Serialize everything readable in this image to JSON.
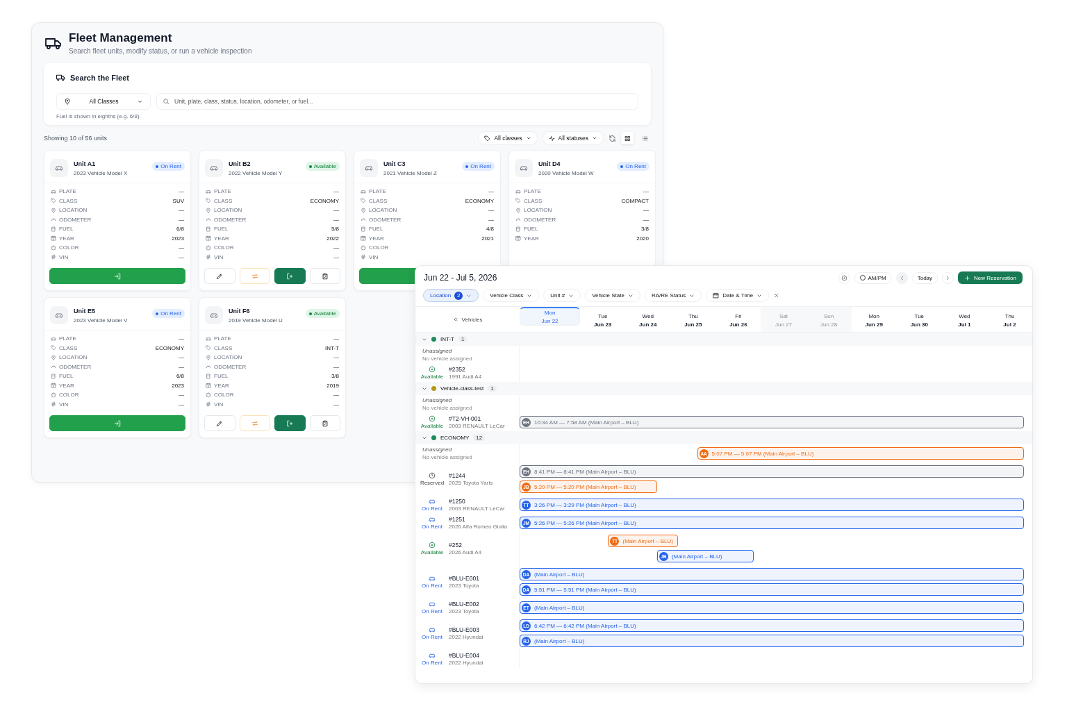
{
  "fleet": {
    "title": "Fleet Management",
    "subtitle": "Search fleet units, modify status, or run a vehicle inspection",
    "search": {
      "title": "Search the Fleet",
      "class_select": "All Classes",
      "placeholder": "Unit, plate, class, status, location, odometer, or fuel...",
      "hint": "Fuel is shown in eighths (e.g. 6/8)."
    },
    "summary": "Showing 10 of 56 units",
    "filters": [
      {
        "kind": "class",
        "label": "All classes"
      },
      {
        "kind": "status",
        "label": "All statuses"
      }
    ],
    "views": [
      {
        "kind": "grid",
        "selected": true
      },
      {
        "kind": "list",
        "selected": false
      }
    ],
    "cards": [
      {
        "unit": "Unit A1",
        "model": "2023 Vehicle Model X",
        "status": {
          "label": "On Rent",
          "kind": "rent"
        },
        "fields": [
          {
            "kind": "plate",
            "label": "PLATE",
            "value": "—"
          },
          {
            "kind": "class",
            "label": "CLASS",
            "value": "SUV"
          },
          {
            "kind": "location",
            "label": "LOCATION",
            "value": "—"
          },
          {
            "kind": "odometer",
            "label": "ODOMETER",
            "value": "—"
          },
          {
            "kind": "fuel",
            "label": "FUEL",
            "value": "6/8"
          },
          {
            "kind": "year",
            "label": "YEAR",
            "value": "2023"
          },
          {
            "kind": "color",
            "label": "COLOR",
            "value": "—"
          },
          {
            "kind": "vin",
            "label": "VIN",
            "value": "—"
          }
        ],
        "actions": [
          {
            "kind": "checkin"
          }
        ]
      },
      {
        "unit": "Unit B2",
        "model": "2022 Vehicle Model Y",
        "status": {
          "label": "Available",
          "kind": "available"
        },
        "fields": [
          {
            "kind": "plate",
            "label": "PLATE",
            "value": "—"
          },
          {
            "kind": "class",
            "label": "CLASS",
            "value": "ECONOMY"
          },
          {
            "kind": "location",
            "label": "LOCATION",
            "value": "—"
          },
          {
            "kind": "odometer",
            "label": "ODOMETER",
            "value": "—"
          },
          {
            "kind": "fuel",
            "label": "FUEL",
            "value": "5/8"
          },
          {
            "kind": "year",
            "label": "YEAR",
            "value": "2022"
          },
          {
            "kind": "color",
            "label": "COLOR",
            "value": "—"
          },
          {
            "kind": "vin",
            "label": "VIN",
            "value": "—"
          }
        ],
        "actions": [
          {
            "kind": "edit"
          },
          {
            "kind": "swap"
          },
          {
            "kind": "checkout"
          },
          {
            "kind": "inspect"
          }
        ]
      },
      {
        "unit": "Unit C3",
        "model": "2021 Vehicle Model Z",
        "status": {
          "label": "On Rent",
          "kind": "rent"
        },
        "fields": [
          {
            "kind": "plate",
            "label": "PLATE",
            "value": "—"
          },
          {
            "kind": "class",
            "label": "CLASS",
            "value": "ECONOMY"
          },
          {
            "kind": "location",
            "label": "LOCATION",
            "value": "—"
          },
          {
            "kind": "odometer",
            "label": "ODOMETER",
            "value": "—"
          },
          {
            "kind": "fuel",
            "label": "FUEL",
            "value": "4/8"
          },
          {
            "kind": "year",
            "label": "YEAR",
            "value": "2021"
          },
          {
            "kind": "color",
            "label": "COLOR"
          },
          {
            "kind": "vin",
            "label": "VIN"
          }
        ],
        "actions": [
          {
            "kind": "checkin"
          }
        ]
      },
      {
        "unit": "Unit D4",
        "model": "2020 Vehicle Model W",
        "status": {
          "label": "On Rent",
          "kind": "rent"
        },
        "fields": [
          {
            "kind": "plate",
            "label": "PLATE",
            "value": "—"
          },
          {
            "kind": "class",
            "label": "CLASS",
            "value": "COMPACT"
          },
          {
            "kind": "location",
            "label": "LOCATION",
            "value": "—"
          },
          {
            "kind": "odometer",
            "label": "ODOMETER",
            "value": "—"
          },
          {
            "kind": "fuel",
            "label": "FUEL",
            "value": "3/8"
          },
          {
            "kind": "year",
            "label": "YEAR",
            "value": "2020"
          }
        ]
      },
      {
        "unit": "Unit E5",
        "model": "2023 Vehicle Model V",
        "status": {
          "label": "On Rent",
          "kind": "rent"
        },
        "fields": [
          {
            "kind": "plate",
            "label": "PLATE",
            "value": "—"
          },
          {
            "kind": "class",
            "label": "CLASS",
            "value": "ECONOMY"
          },
          {
            "kind": "location",
            "label": "LOCATION",
            "value": "—"
          },
          {
            "kind": "odometer",
            "label": "ODOMETER",
            "value": "—"
          },
          {
            "kind": "fuel",
            "label": "FUEL",
            "value": "6/8"
          },
          {
            "kind": "year",
            "label": "YEAR",
            "value": "2023"
          },
          {
            "kind": "color",
            "label": "COLOR",
            "value": "—"
          },
          {
            "kind": "vin",
            "label": "VIN",
            "value": "—"
          }
        ],
        "actions": [
          {
            "kind": "checkin"
          }
        ]
      },
      {
        "unit": "Unit F6",
        "model": "2019 Vehicle Model U",
        "status": {
          "label": "Available",
          "kind": "available"
        },
        "fields": [
          {
            "kind": "plate",
            "label": "PLATE",
            "value": "—"
          },
          {
            "kind": "class",
            "label": "CLASS",
            "value": "INT-T"
          },
          {
            "kind": "location",
            "label": "LOCATION",
            "value": "—"
          },
          {
            "kind": "odometer",
            "label": "ODOMETER",
            "value": "—"
          },
          {
            "kind": "fuel",
            "label": "FUEL",
            "value": "3/8"
          },
          {
            "kind": "year",
            "label": "YEAR",
            "value": "2019"
          },
          {
            "kind": "color",
            "label": "COLOR",
            "value": "—"
          },
          {
            "kind": "vin",
            "label": "VIN",
            "value": "—"
          }
        ],
        "actions": [
          {
            "kind": "edit"
          },
          {
            "kind": "swap"
          },
          {
            "kind": "checkout"
          },
          {
            "kind": "inspect"
          }
        ]
      }
    ]
  },
  "calendar": {
    "range": "Jun 22 - Jul 5, 2026",
    "ampm": {
      "label": "AM/PM",
      "on": false
    },
    "today": "Today",
    "new_button": "New Reservation",
    "filters": [
      {
        "kind": "select",
        "label": "Location",
        "count": "2",
        "selected": true
      },
      {
        "kind": "select",
        "label": "Vehicle Class",
        "selected": false
      },
      {
        "kind": "select",
        "label": "Unit #",
        "selected": false
      },
      {
        "kind": "select",
        "label": "Vehicle State",
        "selected": false
      },
      {
        "kind": "select",
        "label": "RA/RE Status",
        "selected": false
      },
      {
        "kind": "date",
        "label": "Date & Time",
        "selected": false
      }
    ],
    "vehicles_label": "Vehicles",
    "days": [
      {
        "dow": "Mon",
        "date": "Jun 22",
        "selected": true,
        "weekend": false
      },
      {
        "dow": "Tue",
        "date": "Jun 23",
        "selected": false,
        "weekend": false
      },
      {
        "dow": "Wed",
        "date": "Jun 24",
        "selected": false,
        "weekend": false
      },
      {
        "dow": "Thu",
        "date": "Jun 25",
        "selected": false,
        "weekend": false
      },
      {
        "dow": "Fri",
        "date": "Jun 26",
        "selected": false,
        "weekend": false
      },
      {
        "dow": "Sat",
        "date": "Jun 27",
        "selected": false,
        "weekend": true
      },
      {
        "dow": "Sun",
        "date": "Jun 28",
        "selected": false,
        "weekend": true
      },
      {
        "dow": "Mon",
        "date": "Jun 29",
        "selected": false,
        "weekend": false
      },
      {
        "dow": "Tue",
        "date": "Jun 30",
        "selected": false,
        "weekend": false
      },
      {
        "dow": "Wed",
        "date": "Jul 1",
        "selected": false,
        "weekend": false
      },
      {
        "dow": "Thu",
        "date": "Jul 2",
        "selected": false,
        "weekend": false
      }
    ],
    "groups": [
      {
        "name": "INT-T",
        "color": "#1f8a5c",
        "count": "1",
        "expanded": true,
        "rows": [
          {
            "kind": "unassigned",
            "title": "Unassigned",
            "sub": "No vehicle assigned",
            "lanes": []
          },
          {
            "kind": "vehicle",
            "unit": "#2352",
            "model": "1991 Audi A4",
            "status": {
              "label": "Available",
              "kind": "available"
            },
            "lanes": []
          }
        ]
      },
      {
        "name": "Vehicle-class-test",
        "color": "#b8961c",
        "count": "1",
        "expanded": true,
        "rows": [
          {
            "kind": "unassigned",
            "title": "Unassigned",
            "sub": "No vehicle assigned",
            "lanes": []
          },
          {
            "kind": "vehicle",
            "unit": "#T2-VH-001",
            "model": "2003 RENAULT LeCar",
            "status": {
              "label": "Available",
              "kind": "available"
            },
            "lanes": [
              [
                {
                  "initials": "EH",
                  "text": "10:34 AM — 7:58 AM (Main Airport – BLU)",
                  "color": "#6b7280"
                }
              ]
            ]
          }
        ]
      },
      {
        "name": "ECONOMY",
        "color": "#1f8a5c",
        "count": "12",
        "expanded": true,
        "rows": [
          {
            "kind": "unassigned",
            "title": "Unassigned",
            "sub": "No vehicle assigned",
            "lanes": [
              [
                {
                  "initials": "AA",
                  "text": "5:07 PM — 5:07 PM (Main Airport – BLU)",
                  "color": "#f06a10"
                }
              ]
            ]
          },
          {
            "kind": "vehicle",
            "unit": "#1244",
            "model": "2025 Toyota Yaris",
            "status": {
              "label": "Reserved",
              "kind": "reserved"
            },
            "lanes": [
              [
                {
                  "initials": "EH",
                  "text": "8:41 PM — 8:41 PM (Main Airport – BLU)",
                  "color": "#6b7280"
                }
              ],
              [
                {
                  "initials": "JB",
                  "text": "5:20 PM — 5:20 PM (Main Airport – BLU)",
                  "color": "#f06a10"
                }
              ]
            ]
          },
          {
            "kind": "vehicle",
            "unit": "#1250",
            "model": "2003 RENAULT LeCar",
            "status": {
              "label": "On Rent",
              "kind": "rent"
            },
            "lanes": [
              [
                {
                  "initials": "TT",
                  "text": "3:26 PM — 3:29 PM (Main Airport – BLU)",
                  "color": "#2563eb"
                }
              ]
            ]
          },
          {
            "kind": "vehicle",
            "unit": "#1251",
            "model": "2026 Alfa Romeo Giulia",
            "status": {
              "label": "On Rent",
              "kind": "rent"
            },
            "lanes": [
              [
                {
                  "initials": "JM",
                  "text": "5:26 PM — 5:26 PM (Main Airport – BLU)",
                  "color": "#2563eb"
                }
              ]
            ]
          },
          {
            "kind": "vehicle",
            "unit": "#252",
            "model": "2026 Audi A4",
            "status": {
              "label": "Available",
              "kind": "available"
            },
            "lanes": [
              [
                {
                  "initials": "TT",
                  "text": "(Main Airport – BLU)",
                  "color": "#f06a10"
                }
              ],
              [
                {
                  "initials": "JB",
                  "text": "(Main Airport – BLU)",
                  "color": "#2563eb"
                }
              ]
            ]
          },
          {
            "kind": "vehicle",
            "unit": "#BLU-E001",
            "model": "2023 Toyota",
            "status": {
              "label": "On Rent",
              "kind": "rent"
            },
            "lanes": [
              [
                {
                  "initials": "DA",
                  "text": "(Main Airport – BLU)",
                  "color": "#2563eb"
                }
              ],
              [
                {
                  "initials": "DA",
                  "text": "5:51 PM — 5:51 PM (Main Airport – BLU)",
                  "color": "#2563eb"
                }
              ]
            ]
          },
          {
            "kind": "vehicle",
            "unit": "#BLU-E002",
            "model": "2023 Toyota",
            "status": {
              "label": "On Rent",
              "kind": "rent"
            },
            "lanes": [
              [
                {
                  "initials": "ET",
                  "text": "(Main Airport – BLU)",
                  "color": "#2563eb"
                }
              ]
            ]
          },
          {
            "kind": "vehicle",
            "unit": "#BLU-E003",
            "model": "2022 Hyundai",
            "status": {
              "label": "On Rent",
              "kind": "rent"
            },
            "lanes": [
              [
                {
                  "initials": "LD",
                  "text": "6:42 PM — 6:42 PM (Main Airport – BLU)",
                  "color": "#2563eb"
                }
              ],
              [
                {
                  "initials": "RJ",
                  "text": "(Main Airport – BLU)",
                  "color": "#2563eb"
                }
              ]
            ]
          },
          {
            "kind": "vehicle",
            "unit": "#BLU-E004",
            "model": "2022 Hyundai",
            "status": {
              "label": "On Rent",
              "kind": "rent"
            },
            "lanes": []
          }
        ]
      }
    ]
  }
}
